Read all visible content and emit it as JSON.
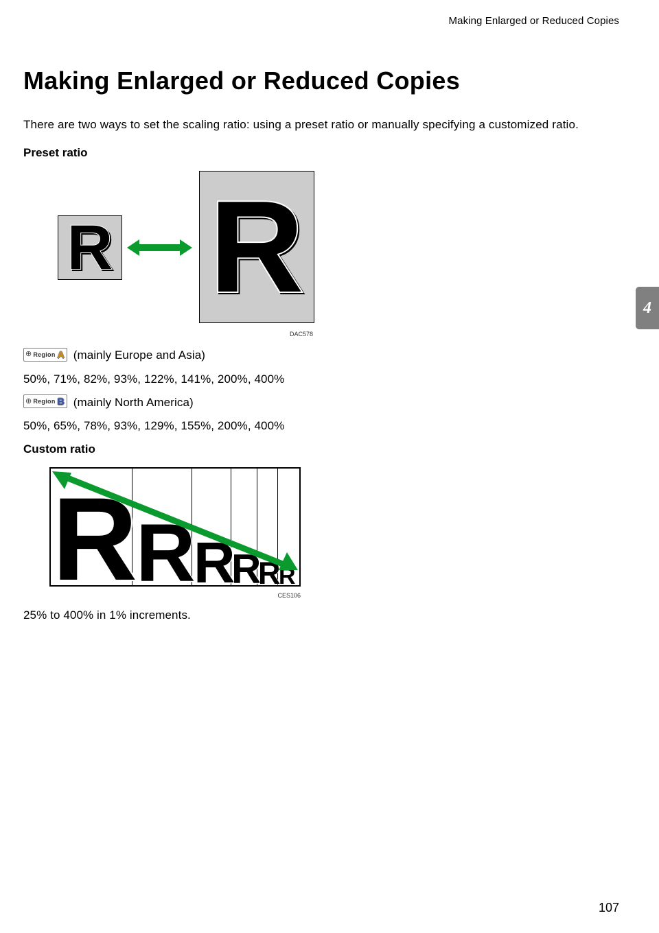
{
  "header": {
    "running_title": "Making Enlarged or Reduced Copies"
  },
  "title": "Making Enlarged or Reduced Copies",
  "intro": "There are two ways to set the scaling ratio: using a preset ratio or manually specifying a customized ratio.",
  "preset": {
    "heading": "Preset ratio",
    "figure_id": "DAC578",
    "region_a": {
      "badge_word": "Region",
      "badge_letter": "A",
      "desc": "(mainly Europe and Asia)",
      "values": "50%, 71%, 82%, 93%, 122%, 141%, 200%, 400%"
    },
    "region_b": {
      "badge_word": "Region",
      "badge_letter": "B",
      "desc": "(mainly North America)",
      "values": "50%, 65%, 78%, 93%, 129%, 155%, 200%, 400%"
    }
  },
  "custom": {
    "heading": "Custom ratio",
    "figure_id": "CES106",
    "desc": "25% to 400% in 1% increments."
  },
  "chapter_tab": "4",
  "page_number": "107"
}
